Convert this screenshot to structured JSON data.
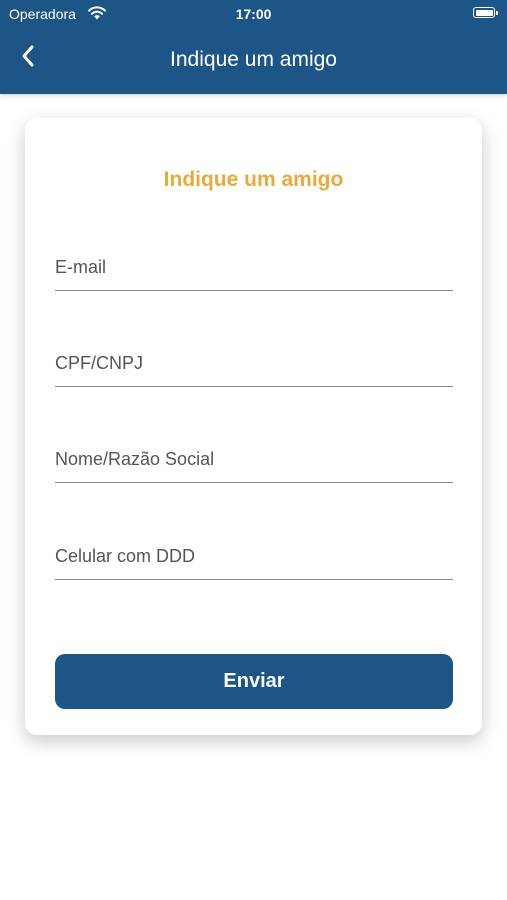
{
  "status_bar": {
    "carrier": "Operadora",
    "time": "17:00"
  },
  "header": {
    "title": "Indique um amigo",
    "back_icon": "chevron-left-icon"
  },
  "form": {
    "title": "Indique um amigo",
    "fields": [
      {
        "placeholder": "E-mail",
        "value": ""
      },
      {
        "placeholder": "CPF/CNPJ",
        "value": ""
      },
      {
        "placeholder": "Nome/Razão Social",
        "value": ""
      },
      {
        "placeholder": "Celular com DDD",
        "value": ""
      }
    ],
    "submit_label": "Enviar"
  },
  "colors": {
    "primary": "#1d5587",
    "accent": "#e9a93b",
    "background": "#ffffff"
  }
}
